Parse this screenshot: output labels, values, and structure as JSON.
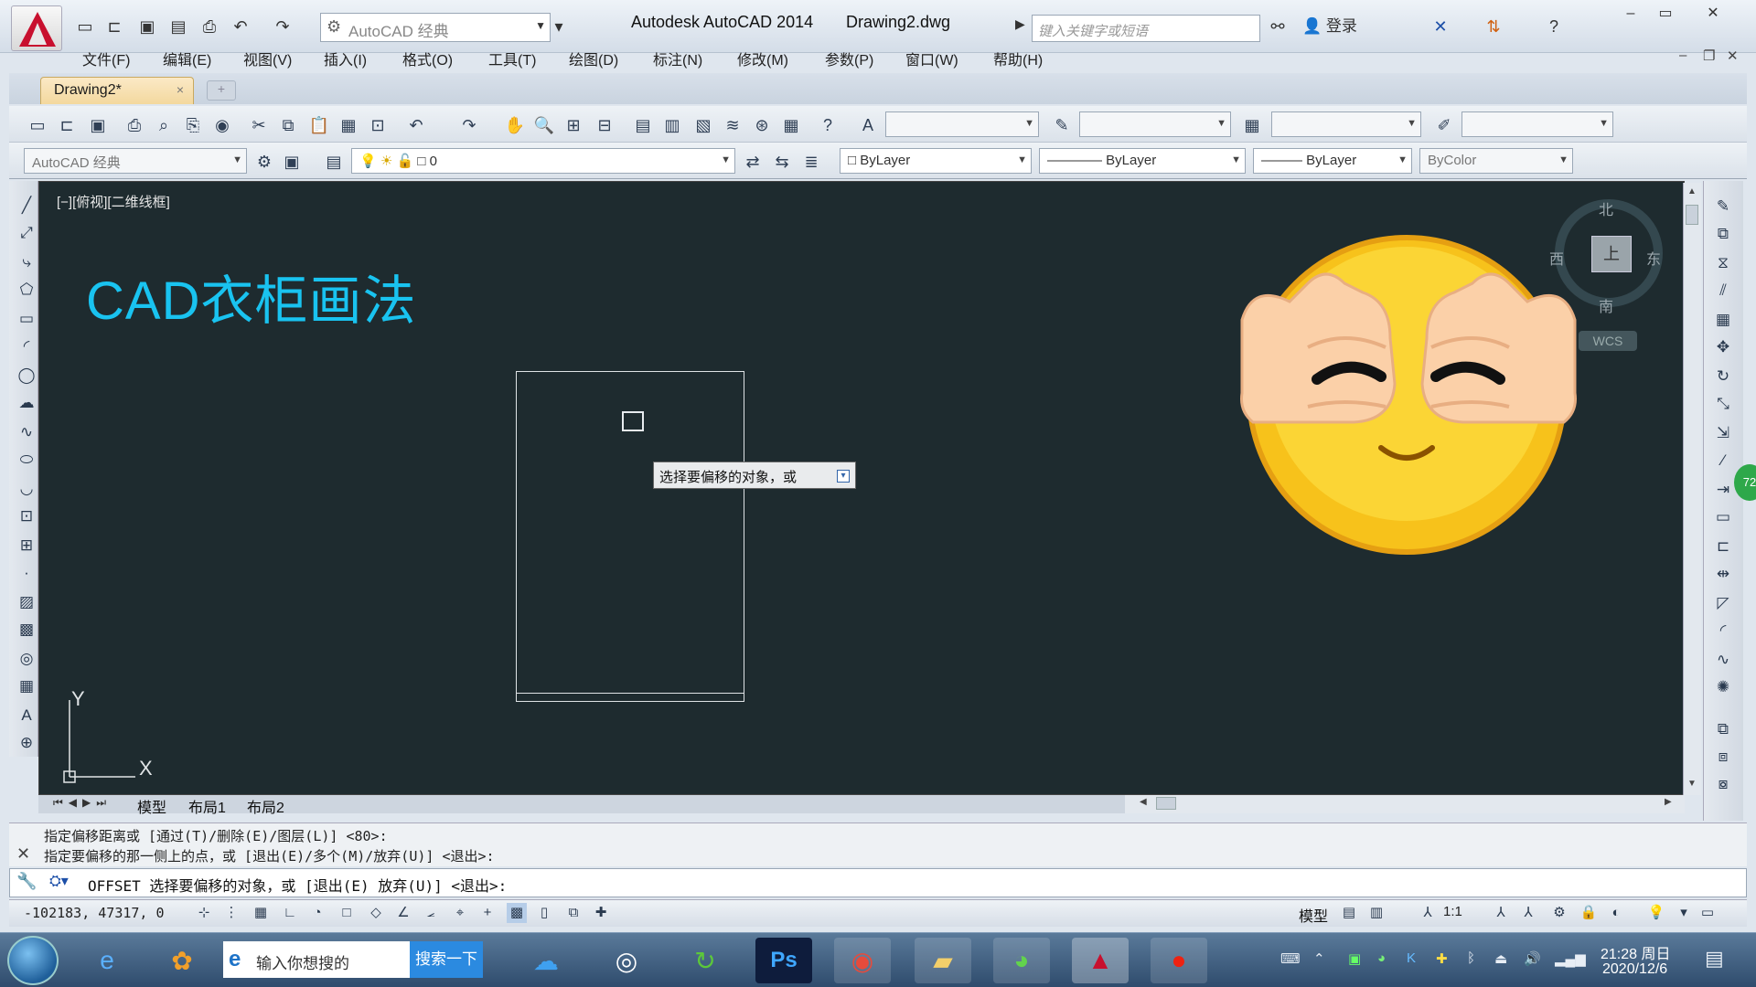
{
  "titlebar": {
    "workspace": "AutoCAD 经典",
    "app_title": "Autodesk AutoCAD 2014",
    "file_name": "Drawing2.dwg",
    "search_placeholder": "键入关键字或短语",
    "login": "登录"
  },
  "menu": [
    "文件(F)",
    "编辑(E)",
    "视图(V)",
    "插入(I)",
    "格式(O)",
    "工具(T)",
    "绘图(D)",
    "标注(N)",
    "修改(M)",
    "参数(P)",
    "窗口(W)",
    "帮助(H)"
  ],
  "doc_tab": {
    "label": "Drawing2*",
    "close": "×"
  },
  "toolbar2": {
    "workspace": "AutoCAD 经典",
    "layer": "0",
    "color": "ByLayer",
    "linetype": "ByLayer",
    "lineweight": "ByLayer",
    "plotstyle": "ByColor"
  },
  "canvas": {
    "view_label": "[−][俯视][二维线框]",
    "title_text": "CAD衣柜画法",
    "tooltip": "选择要偏移的对象，或",
    "ucs_x": "X",
    "ucs_y": "Y"
  },
  "viewcube": {
    "north": "北",
    "south": "南",
    "east": "东",
    "west": "西",
    "center": "上",
    "wcs": "WCS"
  },
  "layout_tabs": [
    "模型",
    "布局1",
    "布局2"
  ],
  "command": {
    "history": [
      "指定偏移距离或 [通过(T)/删除(E)/图层(L)] <80>:",
      "指定要偏移的那一侧上的点，或 [退出(E)/多个(M)/放弃(U)] <退出>:"
    ],
    "input": "OFFSET 选择要偏移的对象，或 [退出(E) 放弃(U)] <退出>:"
  },
  "status": {
    "coords": "-102183, 47317, 0",
    "model": "模型",
    "scale": "1:1"
  },
  "taskbar": {
    "search_placeholder": "输入你想搜的",
    "search_button": "搜索一下",
    "time": "21:28 周日",
    "date": "2020/12/6"
  },
  "badge": "72",
  "colors": {
    "canvas_bg": "#1e2b2f",
    "title_text": "#19c3f0",
    "autocad_red": "#c8102e"
  }
}
